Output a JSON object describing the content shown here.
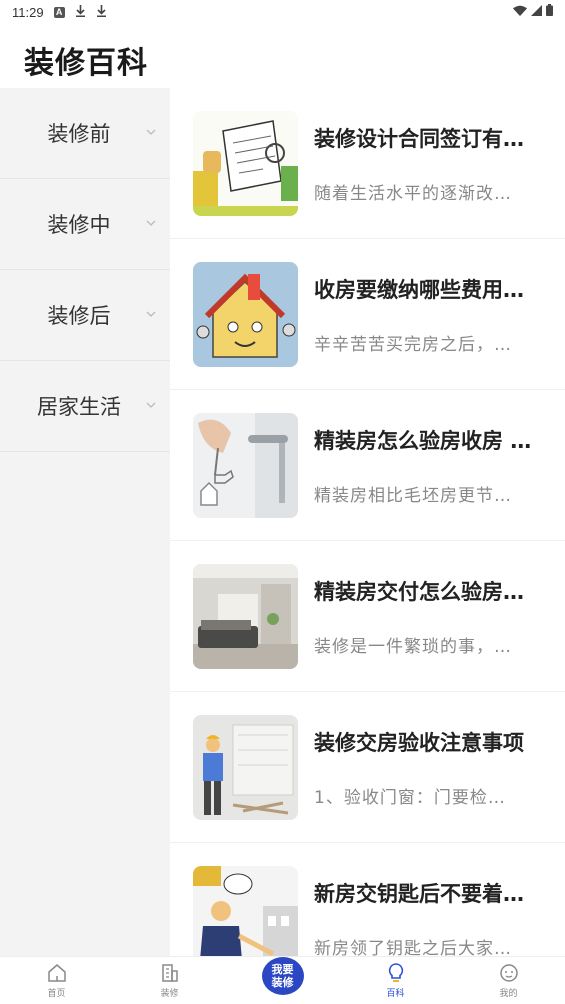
{
  "status_bar": {
    "time": "11:29",
    "icons": [
      "a-icon",
      "download-icon",
      "download-icon",
      "wifi-icon",
      "signal-icon",
      "battery-icon"
    ]
  },
  "page": {
    "title": "装修百科"
  },
  "sidebar": {
    "items": [
      {
        "label": "装修前"
      },
      {
        "label": "装修中"
      },
      {
        "label": "装修后"
      },
      {
        "label": "居家生活"
      }
    ]
  },
  "articles": [
    {
      "title": "装修设计合同签订有…",
      "summary": "随着生活水平的逐渐改…"
    },
    {
      "title": "收房要缴纳哪些费用…",
      "summary": "辛辛苦苦买完房之后，…"
    },
    {
      "title": "精装房怎么验房收房 …",
      "summary": "精装房相比毛坯房更节…"
    },
    {
      "title": "精装房交付怎么验房…",
      "summary": "装修是一件繁琐的事，…"
    },
    {
      "title": "装修交房验收注意事项",
      "summary": "1、验收门窗：门要检…"
    },
    {
      "title": "新房交钥匙后不要着…",
      "summary": "新房领了钥匙之后大家…"
    }
  ],
  "bottom_nav": {
    "home": "首页",
    "renovate": "装修",
    "center_line1": "我要",
    "center_line2": "装修",
    "encyclopedia": "百科",
    "mine": "我的"
  },
  "colors": {
    "accent": "#2c47c4",
    "active_nav": "#2d4ed8",
    "sidebar_bg": "#f3f3f3"
  }
}
